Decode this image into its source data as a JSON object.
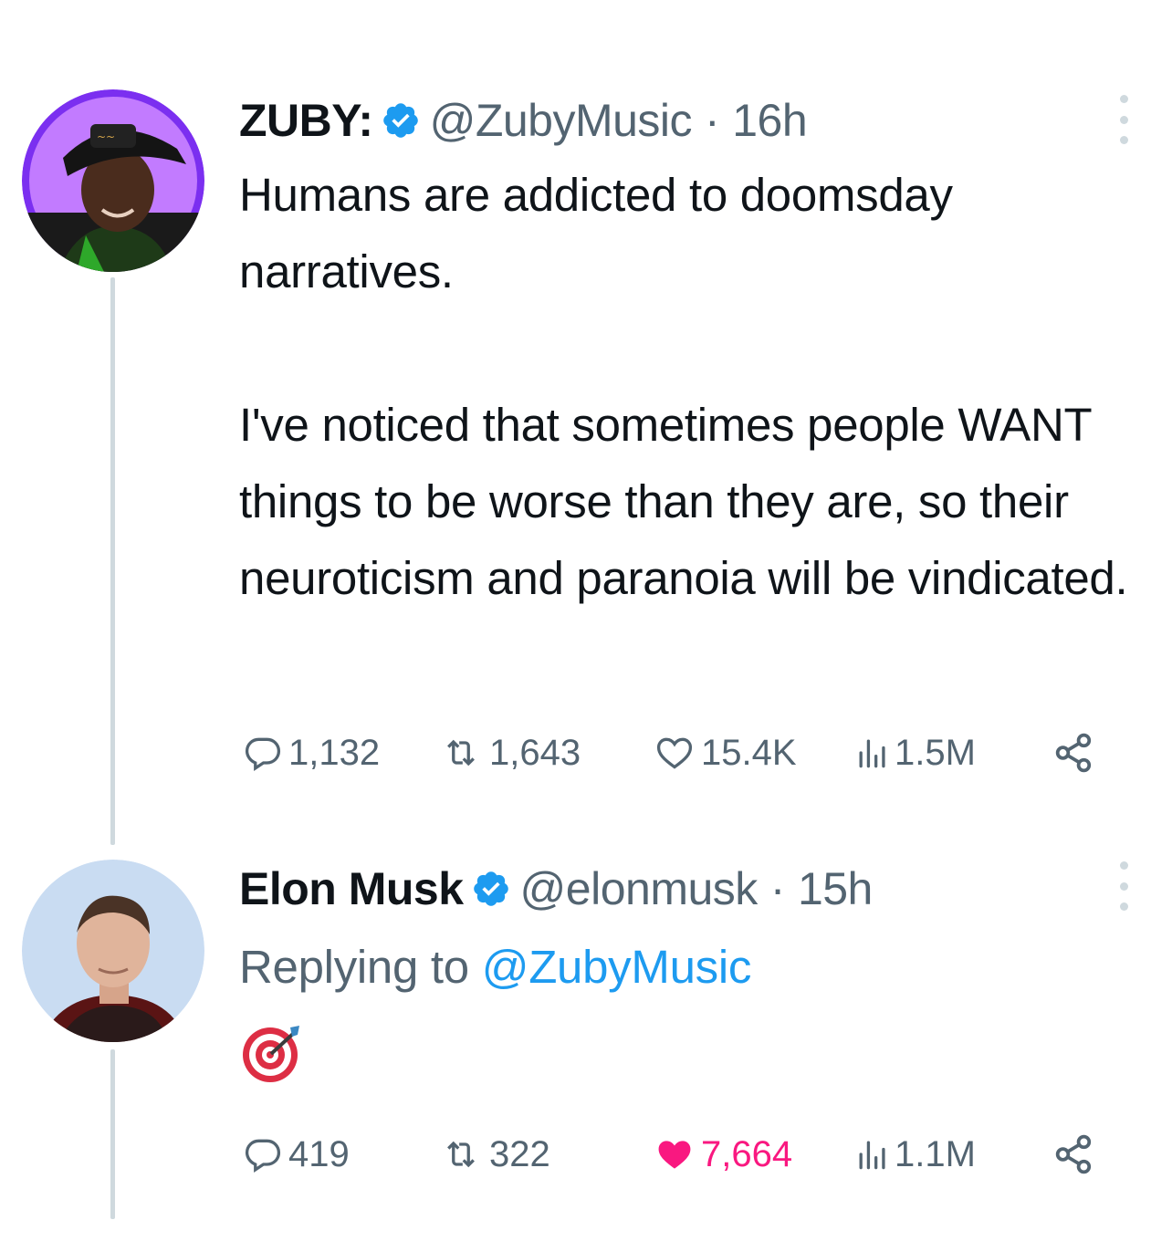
{
  "tweets": [
    {
      "display_name": "ZUBY:",
      "verified": true,
      "handle": "@ZubyMusic",
      "separator": "·",
      "time": "16h",
      "paragraphs": [
        "Humans are addicted to doomsday narratives.",
        "I've noticed that sometimes people WANT things to be worse than they are, so their neuroticism and paranoia will be vindicated."
      ],
      "stats": {
        "replies": "1,132",
        "retweets": "1,643",
        "likes": "15.4K",
        "views": "1.5M"
      },
      "liked": false
    },
    {
      "display_name": "Elon Musk",
      "verified": true,
      "handle": "@elonmusk",
      "separator": "·",
      "time": "15h",
      "replying_prefix": "Replying to",
      "replying_to": "@ZubyMusic",
      "body_emoji": "direct-hit-emoji",
      "stats": {
        "replies": "419",
        "retweets": "322",
        "likes": "7,664",
        "views": "1.1M"
      },
      "liked": true
    }
  ],
  "colors": {
    "text": "#0f1419",
    "secondary": "#536471",
    "link": "#1d9bf0",
    "like": "#f91880",
    "verified": "#1d9bf0",
    "thread_line": "#cfd9de",
    "zuby_avatar_ring": "#9b3ff5"
  },
  "icons": [
    "reply-icon",
    "retweet-icon",
    "like-icon",
    "views-icon",
    "share-icon",
    "verified-badge-icon",
    "more-icon"
  ]
}
